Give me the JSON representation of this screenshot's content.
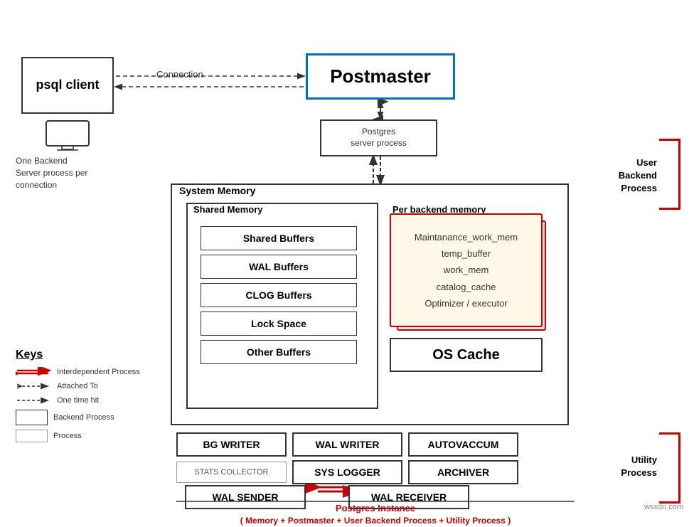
{
  "watermark": "wsxdn.com",
  "psql_client": {
    "label": "psql client"
  },
  "connection": {
    "label": "Connection"
  },
  "postmaster": {
    "label": "Postmaster"
  },
  "pg_server": {
    "label": "Postgres\nserver process",
    "line1": "Postgres",
    "line2": "server process"
  },
  "one_backend": {
    "text": "One Backend\nServer process per\nconnection",
    "line1": "One Backend",
    "line2": "Server process per",
    "line3": "connection"
  },
  "system_memory": {
    "title": "System Memory"
  },
  "shared_memory": {
    "title": "Shared Memory",
    "items": [
      "Shared Buffers",
      "WAL Buffers",
      "CLOG Buffers",
      "Lock Space",
      "Other Buffers"
    ]
  },
  "per_backend": {
    "title": "Per backend memory",
    "items": [
      "Maintanance_work_mem",
      "temp_buffer",
      "work_mem",
      "catalog_cache",
      "Optimizer / executor"
    ]
  },
  "os_cache": {
    "label": "OS Cache"
  },
  "processes_row1": [
    "BG WRITER",
    "WAL WRITER",
    "AUTOVACCUM"
  ],
  "processes_row2": [
    "STATS COLLECTOR",
    "SYS LOGGER",
    "ARCHIVER"
  ],
  "processes_row3": [
    "WAL SENDER",
    "WAL RECEIVER"
  ],
  "user_backend": {
    "label": "User\nBackend\nProcess",
    "line1": "User",
    "line2": "Backend",
    "line3": "Process"
  },
  "utility_process": {
    "label": "Utility\nProcess",
    "line1": "Utility",
    "line2": "Process"
  },
  "pg_instance": {
    "line1": "Postgres Instance",
    "line2": "( Memory + Postmaster + User Backend Process + Utility Process )"
  },
  "keys": {
    "title": "Keys",
    "items": [
      "Interdependent Process",
      "Attached To",
      "One time hit",
      "Backend Process",
      "Process"
    ]
  }
}
